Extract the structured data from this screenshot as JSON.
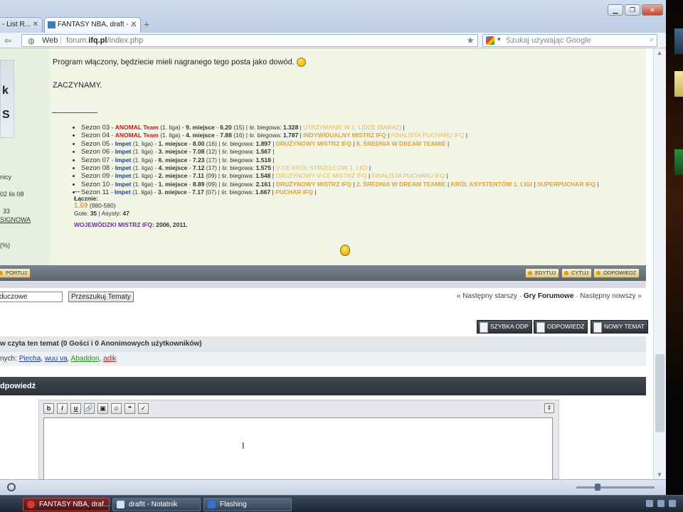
{
  "browser": {
    "tabs": [
      {
        "label": "- List R...",
        "active": false
      },
      {
        "label": "FANTASY NBA, draft - ...",
        "active": true
      }
    ],
    "url_prefix": "Web",
    "url_before": "forum.",
    "url_bold": "ifq.pl",
    "url_after": "/index.php",
    "search_placeholder": "Szukaj używając Google",
    "window_buttons": [
      "minimize",
      "restore",
      "close"
    ]
  },
  "sidebar": {
    "avatar_letters": [
      "k",
      "S"
    ],
    "meta": [
      "nicy",
      "02 lis 08",
      "33",
      "SIGNOWA",
      "(%)"
    ]
  },
  "post": {
    "line1": "Program włączony, będziecie mieli nagranego tego posta jako dowód.",
    "start": "ZACZYNAMY.",
    "seasons": [
      {
        "name": "Sezon 03",
        "team": "ANOMAL Team",
        "team_color": "red",
        "league": "(1. liga)",
        "place": "9. miejsce",
        "score": "6.20",
        "games": "(15)",
        "avg_label": "śr. biegowa:",
        "avg": "1.328",
        "awards": [
          {
            "t": "UTRZYMANIE W 1. LIDZE (BARAŻ)",
            "c": "goldl"
          }
        ]
      },
      {
        "name": "Sezon 04",
        "team": "ANOMAL Team",
        "team_color": "red",
        "league": "(1. liga)",
        "place": "4. miejsce",
        "score": "7.88",
        "games": "(16)",
        "avg_label": "śr. biegowa:",
        "avg": "1.787",
        "awards": [
          {
            "t": "INDYWIDUALNY MISTRZ IFQ",
            "c": "gold"
          },
          {
            "t": "FINALISTA PUCHARU IFQ",
            "c": "goldl"
          }
        ]
      },
      {
        "name": "Sezon 05",
        "team": "Impet",
        "team_color": "blue",
        "league": "(1. liga)",
        "place": "1. miejsce",
        "score": "8.00",
        "games": "(16)",
        "avg_label": "śr. biegowa:",
        "avg": "1.897",
        "awards": [
          {
            "t": "DRUŻYNOWY MISTRZ IFQ",
            "c": "gold"
          },
          {
            "t": "8. ŚREDNIA W DREAM TEAMIE",
            "c": "gold"
          }
        ]
      },
      {
        "name": "Sezon 06",
        "team": "Impet",
        "team_color": "blue",
        "league": "(1. liga)",
        "place": "3. miejsce",
        "score": "7.08",
        "games": "(12)",
        "avg_label": "śr. biegowa:",
        "avg": "1.567",
        "awards": []
      },
      {
        "name": "Sezon 07",
        "team": "Impet",
        "team_color": "blue",
        "league": "(1. liga)",
        "place": "6. miejsce",
        "score": "7.23",
        "games": "(17)",
        "avg_label": "śr. biegowa:",
        "avg": "1.518",
        "awards": []
      },
      {
        "name": "Sezon 08",
        "team": "Impet",
        "team_color": "blue",
        "league": "(1. liga)",
        "place": "4. miejsce",
        "score": "7.12",
        "games": "(17)",
        "avg_label": "śr. biegowa:",
        "avg": "1.575",
        "awards": [
          {
            "t": "V-CE KRÓL STRZELCÓW 1. LIGI",
            "c": "goldl"
          }
        ]
      },
      {
        "name": "Sezon 09",
        "team": "Impet",
        "team_color": "blue",
        "league": "(1. liga)",
        "place": "2. miejsce",
        "score": "7.11",
        "games": "(09)",
        "avg_label": "śr. biegowa:",
        "avg": "1.548",
        "awards": [
          {
            "t": "DRUŻYNOWY V-CE MISTRZ IFQ",
            "c": "goldl"
          },
          {
            "t": "FINALISTA PUCHARU IFQ",
            "c": "goldl"
          }
        ]
      },
      {
        "name": "Sezon 10",
        "team": "Impet",
        "team_color": "blue",
        "league": "(1. liga)",
        "place": "1. miejsce",
        "score": "8.89",
        "games": "(09)",
        "avg_label": "śr. biegowa:",
        "avg": "2.161",
        "awards": [
          {
            "t": "DRUŻYNOWY MISTRZ IFQ",
            "c": "gold"
          },
          {
            "t": "2. ŚREDNIA W DREAM TEAMIE",
            "c": "gold"
          },
          {
            "t": "KRÓL ASYSTENTÓW 1. LIGI",
            "c": "gold"
          },
          {
            "t": "SUPERPUCHAR IFQ",
            "c": "gold"
          }
        ]
      },
      {
        "name": "Sezon 11",
        "team": "Impet",
        "team_color": "blue",
        "league": "(1. liga)",
        "place": "3. miejsce",
        "score": "7.17",
        "games": "(07)",
        "avg_label": "śr. biegowa:",
        "avg": "1.667",
        "awards": [
          {
            "t": "PUCHAR IFQ",
            "c": "gold"
          }
        ]
      }
    ],
    "dash": "—",
    "totals_label": "Łącznie:",
    "totals_value": "1.69",
    "totals_range": "(980-580)",
    "goals_label": "Gole:",
    "goals": "35",
    "assists_label": "Asysty:",
    "assists": "47",
    "champ_label": "WOJEWÓDZKI MISTRZ IFQ:",
    "champ_years": "2006, 2011."
  },
  "postbar": {
    "left_label": "PORTUJ",
    "edit": "EDYTUJ",
    "quote": "CYTUJ",
    "reply": "ODPOWIEDZ"
  },
  "search": {
    "value": "duczowe",
    "button": "Przeszukuj Tematy",
    "prev": "« Następny starszy",
    "forum": "Gry Forumowe",
    "next": "Następny nowszy »"
  },
  "actions": {
    "quick_reply": "SZYBKA ODP",
    "reply": "ODPOWIEDZ",
    "new_topic": "NOWY TEMAT"
  },
  "viewers": {
    "header": "w czyta ten temat (0 Gości i 0 Anonimowych użytkowników)",
    "prefix": "nych:",
    "users": [
      {
        "name": "Piecha",
        "color": "blue"
      },
      {
        "name": "wuu va",
        "color": "blue"
      },
      {
        "name": "Abaddon",
        "color": "green"
      },
      {
        "name": "adik",
        "color": "red"
      }
    ]
  },
  "reply": {
    "header": "dpowiedź",
    "tools": [
      "b",
      "i",
      "u"
    ]
  },
  "taskbar": {
    "items": [
      {
        "label": "FANTASY NBA, draf...",
        "active": true
      },
      {
        "label": "draftt - Notatnik",
        "active": false
      },
      {
        "label": "Flashing",
        "active": false
      }
    ]
  }
}
